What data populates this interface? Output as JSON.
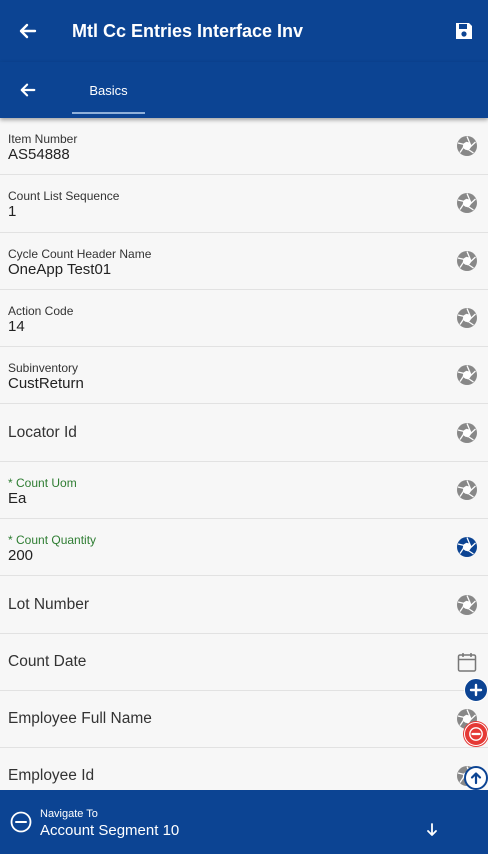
{
  "header": {
    "title": "Mtl Cc Entries Interface Inv",
    "back_icon": "arrow-left-icon",
    "save_icon": "save-icon"
  },
  "tabs": {
    "active": "Basics"
  },
  "colors": {
    "primary": "#0c4493",
    "required_label": "#2e7d32",
    "remove": "#e53935"
  },
  "fields": [
    {
      "label": "Item Number",
      "value": "AS54888",
      "icon": "lens-icon"
    },
    {
      "label": "Count List Sequence",
      "value": "1",
      "icon": "lens-icon"
    },
    {
      "label": "Cycle Count Header Name",
      "value": "OneApp Test01",
      "icon": "lens-icon"
    },
    {
      "label": "Action Code",
      "value": "14",
      "icon": "lens-icon"
    },
    {
      "label": "Subinventory",
      "value": "CustReturn",
      "icon": "lens-icon"
    },
    {
      "label": "Locator Id",
      "value": "",
      "icon": "lens-icon"
    },
    {
      "label": "* Count Uom",
      "value": "Ea",
      "icon": "lens-icon",
      "required": true
    },
    {
      "label": "* Count Quantity",
      "value": "200",
      "icon": "lens-icon",
      "required": true
    },
    {
      "label": "Lot Number",
      "value": "",
      "icon": "lens-icon"
    },
    {
      "label": "Count Date",
      "value": "",
      "icon": "calendar-icon"
    },
    {
      "label": "Employee Full Name",
      "value": "",
      "icon": "lens-icon"
    },
    {
      "label": "Employee Id",
      "value": "",
      "icon": "lens-icon"
    }
  ],
  "navigate": {
    "label": "Navigate To",
    "value": "Account Segment 10"
  }
}
